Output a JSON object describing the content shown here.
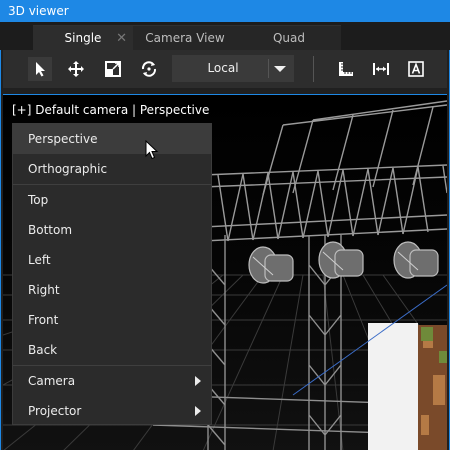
{
  "window": {
    "title": "3D viewer"
  },
  "tabs": [
    {
      "label": "Single",
      "active": true,
      "closable": true
    },
    {
      "label": "Camera View",
      "active": false
    },
    {
      "label": "Quad",
      "active": false
    }
  ],
  "toolbar": {
    "tools": [
      "select-arrow-icon",
      "move-icon",
      "scale-icon",
      "rotate-icon"
    ],
    "coordinate_space": "Local",
    "right_tools": [
      "ruler-corner-icon",
      "measure-distance-icon",
      "text-annotation-icon"
    ]
  },
  "viewport": {
    "caption": "[+] Default camera | Perspective"
  },
  "context_menu": {
    "items": [
      {
        "label": "Perspective",
        "hover": true
      },
      {
        "label": "Orthographic"
      },
      {
        "label": "Top"
      },
      {
        "label": "Bottom"
      },
      {
        "label": "Left"
      },
      {
        "label": "Right"
      },
      {
        "label": "Front"
      },
      {
        "label": "Back"
      },
      {
        "label": "Camera",
        "submenu": true
      },
      {
        "label": "Projector",
        "submenu": true
      }
    ]
  },
  "colors": {
    "accent": "#1e88e5",
    "panel": "#2d2d2d",
    "menu": "#2b2b2b",
    "menu_hover": "#3c3c3c",
    "viewport_bg": "#000000",
    "grid": "#5a5a5a"
  }
}
